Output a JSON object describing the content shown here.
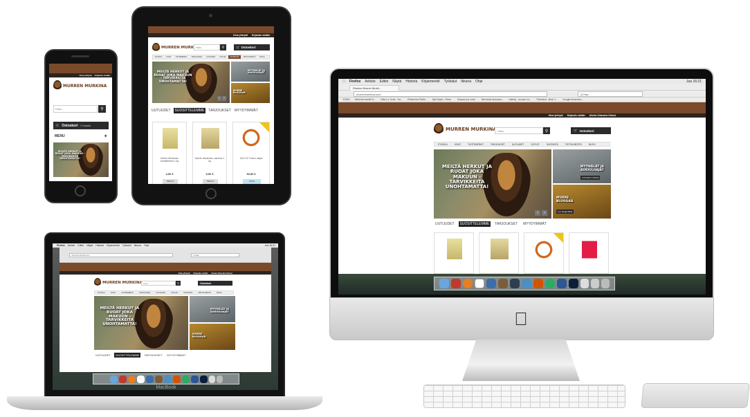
{
  "site": {
    "logo_text": "MURREN MURKINA",
    "top_links": [
      "Oma yhteydi",
      "Kirjaudu sisään"
    ],
    "top_links_imac": [
      "Oma yhteydi",
      "Kirjaudu sisään",
      "Aloeta Ostoskori Kassi"
    ],
    "search_placeholder": "Haku",
    "cart_label": "Ostoskori",
    "cart_count": "0 Tuotetta",
    "nav": [
      "ETUSIVU",
      "KOIAT",
      "TUOTEMERKIT",
      "TARJOUKSET",
      "UUTUUDET",
      "OUTLET",
      "SUOSIKITA",
      "TIETOA MEISTÄ",
      "BLOGI"
    ],
    "hero_text": "MEILTÄ HERKUT JA RUOAT JOKA MAKUUN - TARVIKKEITA UNOHTAMATTA!",
    "hero_text_ipad": "MEILTÄ HERKUT JA RUOAT JOKA MAKUUN - TARVIKKEITA UNOHTAMATTA!",
    "side_a_label": "MYYNÄLÄT JA AUKIOLOAJAT",
    "side_a_sub": "TUTUSTU TÄSTÄ",
    "side_b_label": "MURRE BLOGGAA",
    "side_b_sub": "Lue blogia tästä",
    "tabs": [
      "UUTUUDET",
      "SUOSITTELEMME",
      "TARJOUKSET",
      "MYYDYIMMÄT"
    ],
    "products": [
      {
        "name": "Murren Aikuisnisu Kanafileeseri 1 kg",
        "price": "4,90 €",
        "btn": "TIEDOT"
      },
      {
        "name": "Murren Aikuisnisu Lammas 1 kg",
        "price": "5,90 €",
        "btn": "TIEDOT"
      },
      {
        "name": "Zero DC Fusion valjas",
        "price": "39,90 €",
        "btn": "OSTA"
      }
    ],
    "menu_label": "MENU",
    "menu_plus": "+"
  },
  "imac": {
    "mac_menu": [
      "Firefox",
      "Arkisto",
      "Editoi",
      "Näytä",
      "Historia",
      "Kirjanmerkit",
      "Työkalut",
      "Ikkuna",
      "Ohje"
    ],
    "clock": "Jua 16:21",
    "tab_title": "Etusivu Murren Murki...",
    "url": "murrenmurkina.com",
    "search_engine": "Q Hae",
    "bookmarks": [
      "YHDIS",
      "Artist.de ewolle N...",
      "Osta Lo Jouts - Ka...",
      "Pleisevina Partie...",
      "MyChapin - Etuis...",
      "Buscar por vocil...",
      "Bermuda Anonaus...",
      "Liderky - scuuso vo...",
      "Theestrut - Bear 1...",
      "Google Annevers..."
    ],
    "dock_colors": [
      "#6aa6dd",
      "#c0392b",
      "#e67e22",
      "#7b5c3a",
      "#3b6ea8",
      "#2c3e50",
      "#7a4a2b",
      "#4a90c2",
      "#d35400",
      "#27ae60",
      "#2b5797",
      "#333",
      "#bbb",
      "#999",
      "#ccc"
    ]
  },
  "macbook": {
    "label": "MacBook"
  },
  "colors": {
    "brand_brown": "#7a4a2b",
    "dark": "#2b2522",
    "nav_active": "#7a4a2b"
  }
}
